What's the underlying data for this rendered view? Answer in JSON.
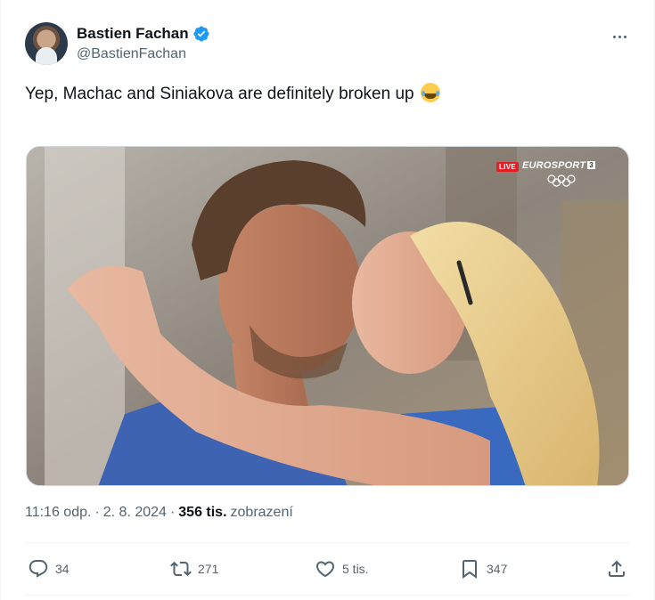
{
  "author": {
    "display_name": "Bastien Fachan",
    "handle": "@BastienFachan",
    "avatar_icon": "profile-photo",
    "verified_icon": "verified-badge-icon",
    "verified_color": "#1d9bf0"
  },
  "tweet": {
    "text": "Yep, Machac and Siniakova are definitely broken up",
    "emoji": "face-with-tears-of-joy"
  },
  "media": {
    "live_label": "LIVE",
    "network_name": "EUROSPORT",
    "network_number": "3"
  },
  "meta": {
    "time": "11:16 odp.",
    "separator1": "·",
    "date": "2. 8. 2024",
    "separator2": "·",
    "views_count": "356 tis.",
    "views_label": "zobrazení"
  },
  "actions": {
    "reply_count": "34",
    "retweet_count": "271",
    "like_count": "5 tis.",
    "bookmark_count": "347"
  },
  "colors": {
    "text_primary": "#0f1419",
    "text_secondary": "#536471",
    "border": "#eff3f4"
  }
}
